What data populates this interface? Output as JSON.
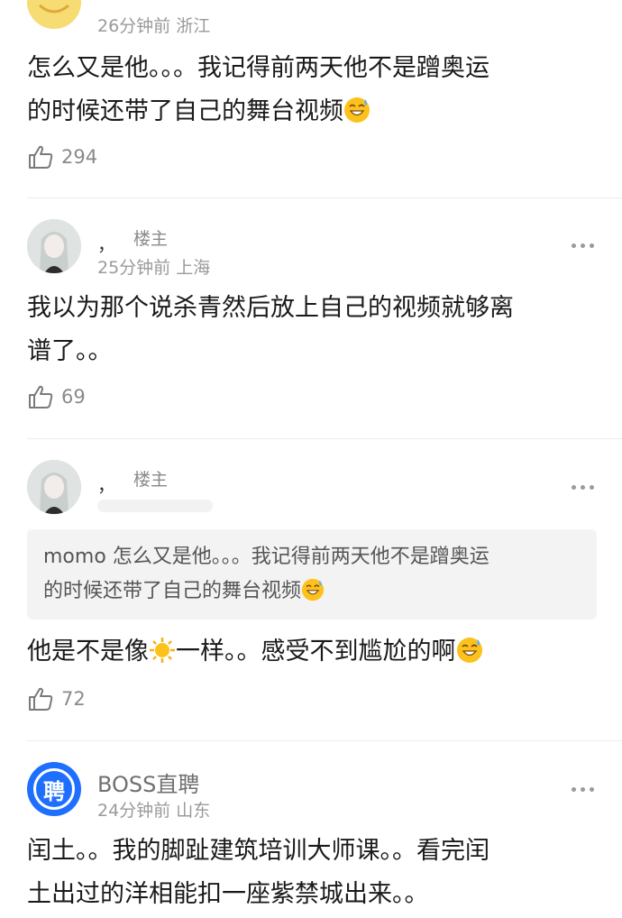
{
  "comment1": {
    "meta": "26分钟前 浙江",
    "text_line1": "怎么又是他。。。我记得前两天他不是蹭奥运",
    "text_line2": "的时候还带了自己的舞台视频",
    "likes": "294",
    "emoji_icon": "grinning-sweat-emoji"
  },
  "comment2": {
    "name": "，",
    "badge": "楼主",
    "meta": "25分钟前 上海",
    "text_line1": "我以为那个说杀青然后放上自己的视频就够离",
    "text_line2": "谱了。。",
    "likes": "69"
  },
  "comment3": {
    "name": "，",
    "badge": "楼主",
    "quote_line1": "momo 怎么又是他。。。我记得前两天他不是蹭奥运",
    "quote_line2": "的时候还带了自己的舞台视频",
    "text_before": "他是不是像",
    "text_after": "一样。。感受不到尴尬的啊",
    "likes": "72",
    "sun_icon": "sun-emoji"
  },
  "comment4": {
    "name": "BOSS直聘",
    "avatar_char": "聘",
    "meta": "24分钟前 山东",
    "text_line1": "闰土。。我的脚趾建筑培训大师课。。看完闰",
    "text_line2": "土出过的洋相能扣一座紫禁城出来。。"
  },
  "colors": {
    "accent_blue": "#1f6fff",
    "meta_gray": "#9a9a9a"
  }
}
